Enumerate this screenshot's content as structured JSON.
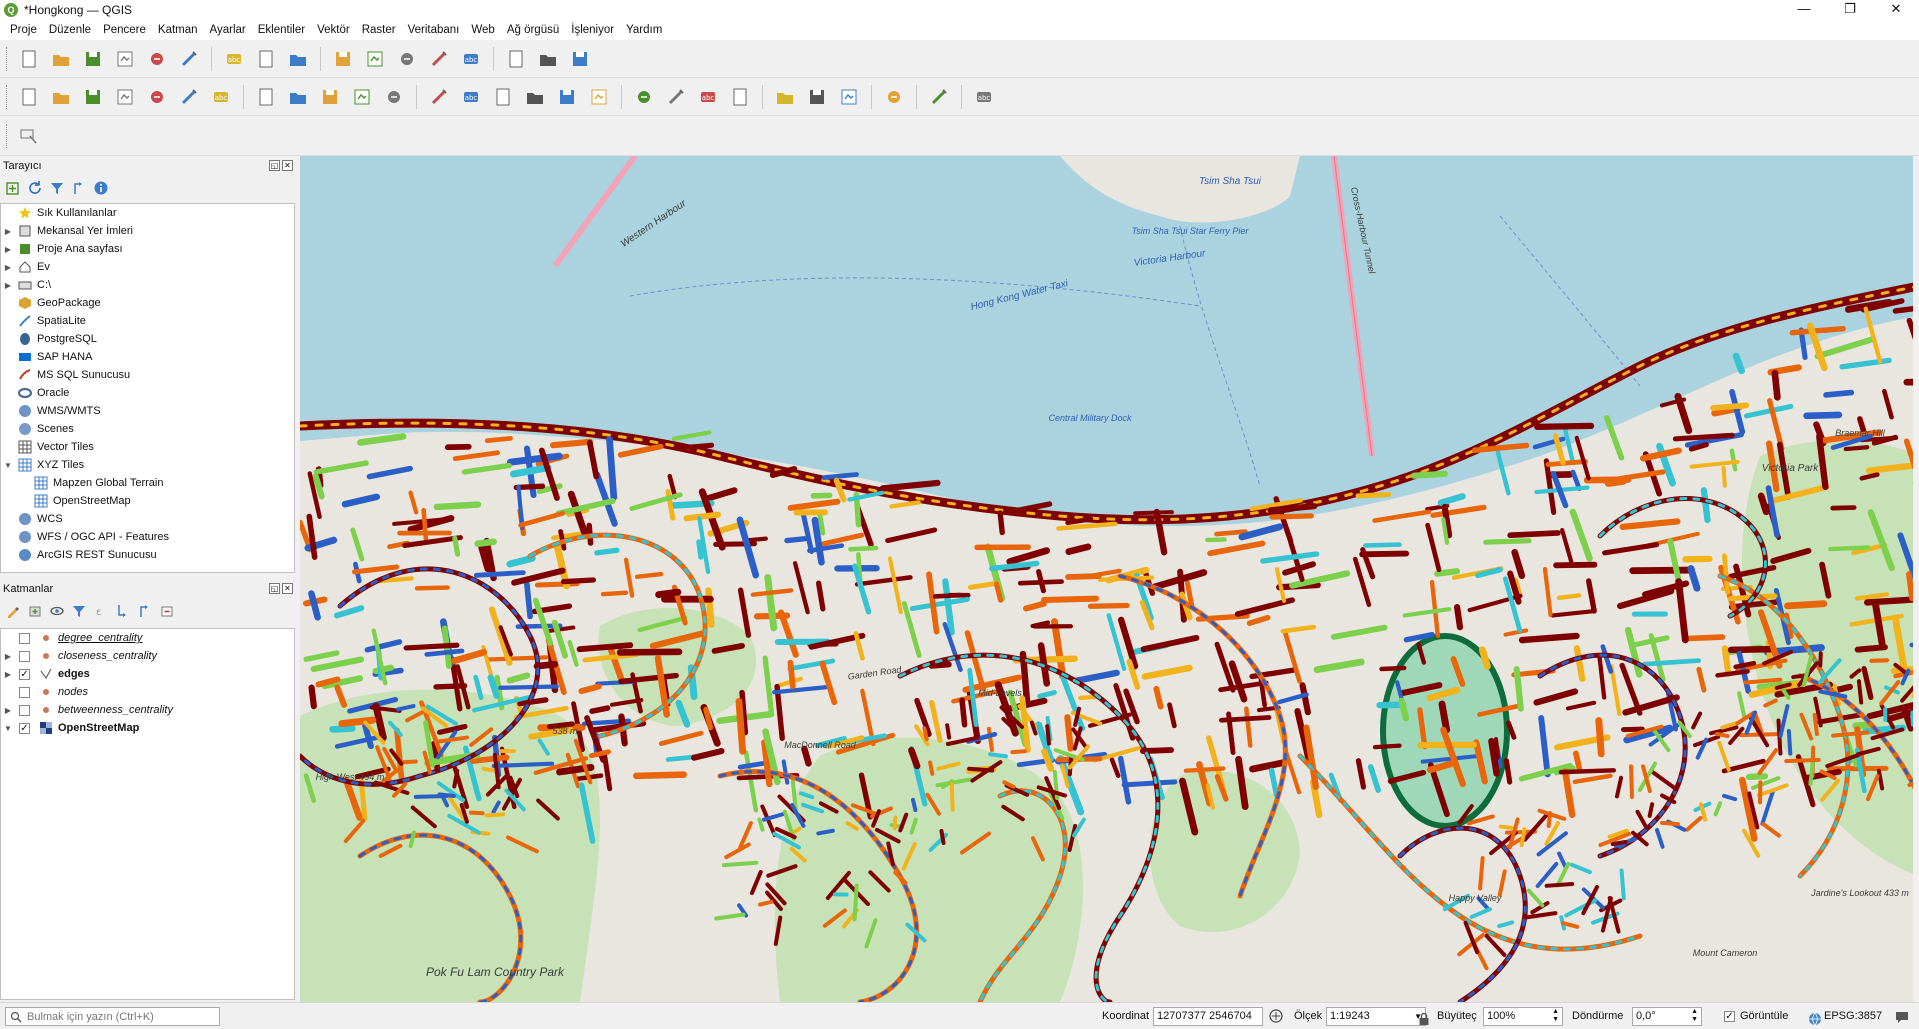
{
  "window": {
    "title": "*Hongkong — QGIS",
    "controls": [
      "—",
      "❐",
      "✕"
    ]
  },
  "menu": [
    "Proje",
    "Düzenle",
    "Pencere",
    "Katman",
    "Ayarlar",
    "Eklentiler",
    "Vektör",
    "Raster",
    "Veritabanı",
    "Web",
    "Ağ örgüsü",
    "İşleniyor",
    "Yardım"
  ],
  "toolbar_icons": {
    "row1": [
      "new-project-icon",
      "open-project-icon",
      "save-project-icon",
      "new-print-layout-icon",
      "layout-manager-icon",
      "style-manager-icon",
      "select-features-icon",
      "select-by-value-icon",
      "deselect-icon",
      "identify-icon",
      "attribute-table-icon",
      "processing-toolbox-icon",
      "statistics-icon",
      "open-field-calculator-icon",
      "measure-icon",
      "map-tips-icon",
      "zoom-icon"
    ],
    "row2": [
      "add-data-source-icon",
      "add-geopackage-icon",
      "add-vector-icon",
      "digitize-icon",
      "add-wms-icon",
      "add-raster-icon",
      "add-mesh-icon",
      "edit-pencil-icon",
      "save-edits-icon",
      "add-feature-icon",
      "move-feature-icon",
      "vertex-tool-icon",
      "delete-icon",
      "cut-icon",
      "copy-icon",
      "paste-icon",
      "undo-icon",
      "redo-icon",
      "label-abc-icon",
      "diagram-icon",
      "label-pin-icon",
      "label-highlight-icon",
      "label-move-icon",
      "label-rotate-icon",
      "label-change-icon",
      "network-analysis-icon",
      "python-console-icon",
      "help-icon"
    ]
  },
  "browser": {
    "title": "Tarayıcı",
    "items": [
      {
        "label": "Sık Kullanılanlar",
        "icon": "star-icon",
        "expandable": false,
        "indent": 0
      },
      {
        "label": "Mekansal Yer İmleri",
        "icon": "bookmark-icon",
        "expandable": true,
        "indent": 0
      },
      {
        "label": "Proje Ana sayfası",
        "icon": "project-home-icon",
        "expandable": true,
        "indent": 0
      },
      {
        "label": "Ev",
        "icon": "home-icon",
        "expandable": true,
        "indent": 0
      },
      {
        "label": "C:\\",
        "icon": "drive-icon",
        "expandable": true,
        "indent": 0
      },
      {
        "label": "GeoPackage",
        "icon": "geopackage-icon",
        "expandable": false,
        "indent": 0
      },
      {
        "label": "SpatiaLite",
        "icon": "spatialite-icon",
        "expandable": false,
        "indent": 0
      },
      {
        "label": "PostgreSQL",
        "icon": "postgresql-icon",
        "expandable": false,
        "indent": 0
      },
      {
        "label": "SAP HANA",
        "icon": "sap-hana-icon",
        "expandable": false,
        "indent": 0
      },
      {
        "label": "MS SQL Sunucusu",
        "icon": "mssql-icon",
        "expandable": false,
        "indent": 0
      },
      {
        "label": "Oracle",
        "icon": "oracle-icon",
        "expandable": false,
        "indent": 0
      },
      {
        "label": "WMS/WMTS",
        "icon": "wms-icon",
        "expandable": false,
        "indent": 0
      },
      {
        "label": "Scenes",
        "icon": "scenes-icon",
        "expandable": false,
        "indent": 0
      },
      {
        "label": "Vector Tiles",
        "icon": "vector-tiles-icon",
        "expandable": false,
        "indent": 0
      },
      {
        "label": "XYZ Tiles",
        "icon": "xyz-tiles-icon",
        "expandable": true,
        "expanded": true,
        "indent": 0
      },
      {
        "label": "Mapzen Global Terrain",
        "icon": "xyz-tiles-icon",
        "expandable": false,
        "indent": 1
      },
      {
        "label": "OpenStreetMap",
        "icon": "xyz-tiles-icon",
        "expandable": false,
        "indent": 1
      },
      {
        "label": "WCS",
        "icon": "wcs-icon",
        "expandable": false,
        "indent": 0
      },
      {
        "label": "WFS / OGC API - Features",
        "icon": "wfs-icon",
        "expandable": false,
        "indent": 0
      },
      {
        "label": "ArcGIS REST Sunucusu",
        "icon": "arcgis-icon",
        "expandable": false,
        "indent": 0
      }
    ]
  },
  "layers": {
    "title": "Katmanlar",
    "items": [
      {
        "label": "degree_centrality",
        "checked": false,
        "expandable": false,
        "symbol": "point-symbol-icon",
        "underline": true
      },
      {
        "label": "closeness_centrality",
        "checked": false,
        "expandable": true,
        "symbol": "point-symbol-icon",
        "underline": false
      },
      {
        "label": "edges",
        "checked": true,
        "expandable": true,
        "symbol": "line-symbol-icon",
        "underline": false
      },
      {
        "label": "nodes",
        "checked": false,
        "expandable": false,
        "symbol": "point-symbol-icon",
        "underline": false
      },
      {
        "label": "betweenness_centrality",
        "checked": false,
        "expandable": true,
        "symbol": "point-symbol-icon",
        "underline": false
      },
      {
        "label": "OpenStreetMap",
        "checked": true,
        "expandable": true,
        "expanded": true,
        "symbol": "raster-icon",
        "underline": false
      }
    ]
  },
  "map": {
    "labels": [
      {
        "text": "Hong Kong Water Taxi"
      },
      {
        "text": "Victoria Harbour"
      },
      {
        "text": "Tsim Sha Tsui"
      },
      {
        "text": "Tsim Sha Tsui Star Ferry Pier"
      },
      {
        "text": "Central Military Dock"
      },
      {
        "text": "Victoria Park"
      },
      {
        "text": "Pok Fu Lam Country Park"
      },
      {
        "text": "High West 494 m"
      },
      {
        "text": "538 m"
      },
      {
        "text": "Jardine's Lookout 433 m"
      },
      {
        "text": "Mount Cameron"
      },
      {
        "text": "Braemar Hill"
      },
      {
        "text": "Western Harbour"
      },
      {
        "text": "Cross-Harbour Tunnel"
      },
      {
        "text": "Garden Road"
      },
      {
        "text": "MacDonnell Road"
      },
      {
        "text": "Mid-Levels"
      },
      {
        "text": "Happy Valley"
      }
    ],
    "colors": {
      "water": "#aad3df",
      "land": "#e9e6df",
      "park": "#c8e2b8",
      "edge_high": "#7f0000",
      "edge_mid": "#e8650a",
      "edge_low": "#2b5fc7"
    }
  },
  "status": {
    "locator_placeholder": "Bulmak için yazın (Ctrl+K)",
    "coord_label": "Koordinat",
    "coord_value": "12707377  2546704",
    "scale_label": "Ölçek",
    "scale_value": "1:19243",
    "magnifier_label": "Büyüteç",
    "magnifier_value": "100%",
    "rotation_label": "Döndürme",
    "rotation_value": "0,0°",
    "render_label": "Görüntüle",
    "render_checked": true,
    "crs": "EPSG:3857"
  }
}
